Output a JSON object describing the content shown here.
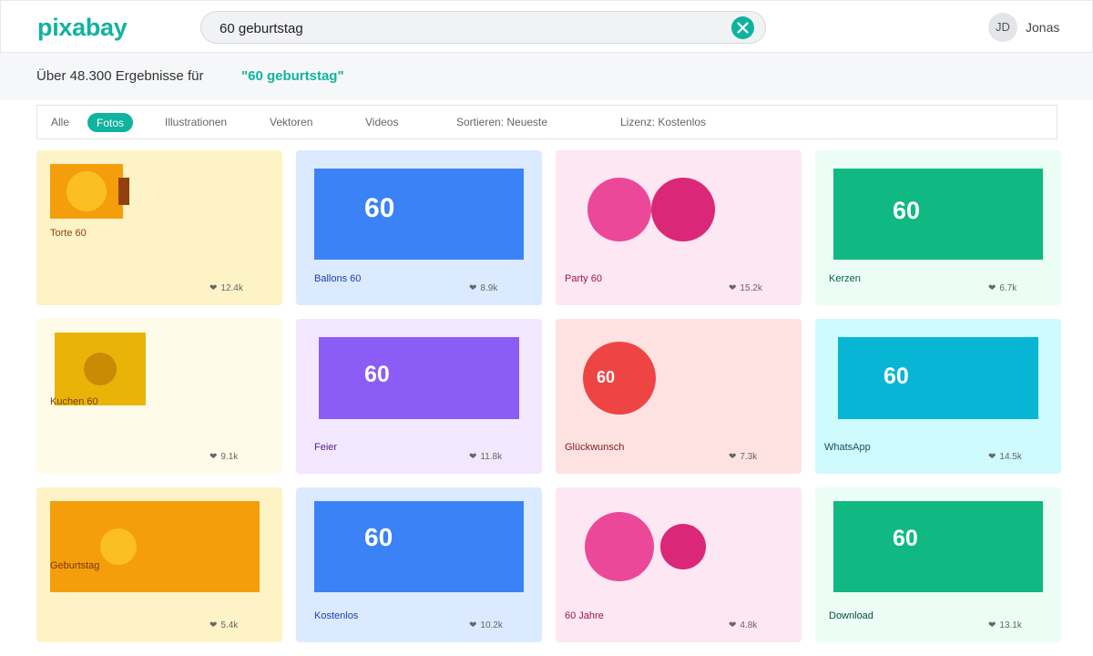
{
  "header": {
    "logo": "pixabay",
    "search_value": "60 geburtstag",
    "user_initials": "JD",
    "user_name": "Jonas"
  },
  "results": {
    "count_text": "Über 48.300 Ergebnisse für",
    "query_text": "\"60 geburtstag\""
  },
  "filters": {
    "all": "Alle",
    "photos": "Fotos",
    "illustrations": "Illustrationen",
    "vectors": "Vektoren",
    "videos": "Videos",
    "sort": "Sortieren: Neueste",
    "license": "Lizenz: Kostenlos"
  },
  "colors": {
    "accent": "#0fb39e"
  },
  "cards": [
    {
      "label": "Torte 60",
      "likes": "12.4k",
      "bg": "#fef3c7"
    },
    {
      "label": "Ballons 60",
      "likes": "8.9k",
      "bg": "#dbeafe",
      "number": "60"
    },
    {
      "label": "Party 60",
      "likes": "15.2k",
      "bg": "#fce7f3"
    },
    {
      "label": "Kerzen",
      "likes": "6.7k",
      "bg": "#ecfdf5",
      "number": "60"
    },
    {
      "label": "Kuchen 60",
      "likes": "9.1k",
      "bg": "#fefce8"
    },
    {
      "label": "Feier",
      "likes": "11.8k",
      "bg": "#f3e8ff",
      "number": "60"
    },
    {
      "label": "Glückwunsch",
      "likes": "7.3k",
      "bg": "#fee2e2",
      "number": "60"
    },
    {
      "label": "WhatsApp",
      "likes": "14.5k",
      "bg": "#cffafe",
      "number": "60"
    },
    {
      "label": "Geburtstag",
      "likes": "5.4k",
      "bg": "#fef3c7"
    },
    {
      "label": "Kostenlos",
      "likes": "10.2k",
      "bg": "#dbeafe",
      "number": "60"
    },
    {
      "label": "60 Jahre",
      "likes": "4.8k",
      "bg": "#fce7f3"
    },
    {
      "label": "Download",
      "likes": "13.1k",
      "bg": "#ecfdf5",
      "number": "60"
    }
  ]
}
